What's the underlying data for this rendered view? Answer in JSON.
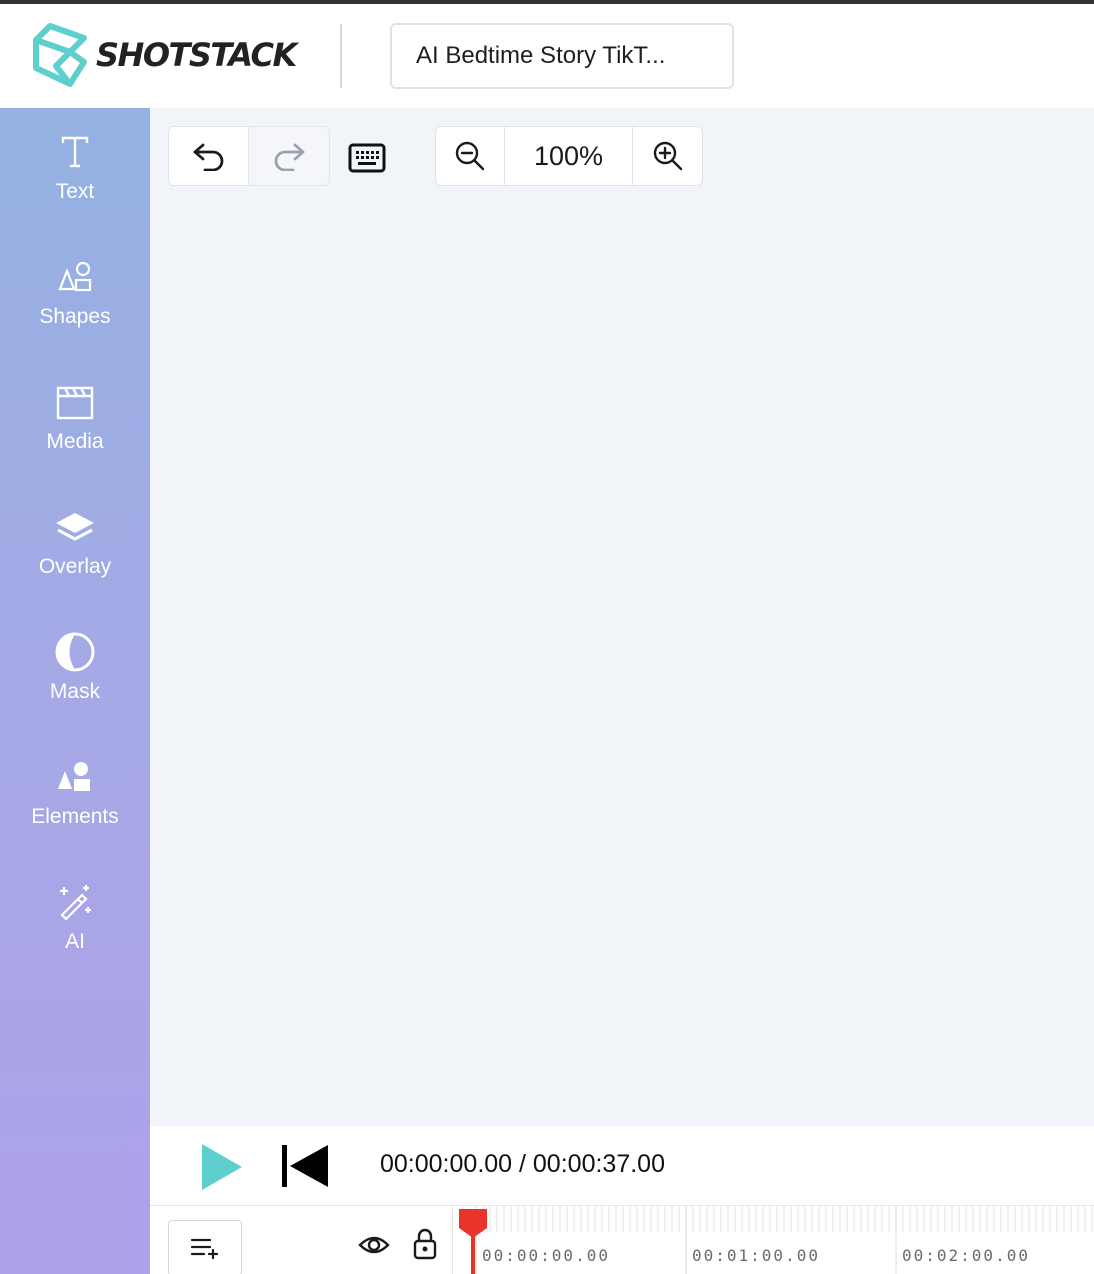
{
  "header": {
    "brand": "SHOTSTACK",
    "project_title": "AI Bedtime Story TikT..."
  },
  "sidebar": {
    "items": [
      {
        "id": "text",
        "label": "Text",
        "icon": "text-icon"
      },
      {
        "id": "shapes",
        "label": "Shapes",
        "icon": "shapes-icon"
      },
      {
        "id": "media",
        "label": "Media",
        "icon": "media-icon"
      },
      {
        "id": "overlay",
        "label": "Overlay",
        "icon": "overlay-icon"
      },
      {
        "id": "mask",
        "label": "Mask",
        "icon": "mask-icon"
      },
      {
        "id": "elements",
        "label": "Elements",
        "icon": "elements-icon"
      },
      {
        "id": "ai",
        "label": "AI",
        "icon": "ai-wand-icon"
      }
    ]
  },
  "toolbar": {
    "zoom": "100%",
    "redo_enabled": false
  },
  "playback": {
    "current_time": "00:00:00.00",
    "total_time": "00:00:37.00",
    "readout": "00:00:00.00 / 00:00:37.00"
  },
  "timeline": {
    "ticks": [
      "00:00:00.00",
      "00:01:00.00",
      "00:02:00.00"
    ]
  },
  "colors": {
    "brand_teal": "#5ecfcf",
    "sidebar_top": "#94b1e2",
    "sidebar_bottom": "#ada1e8",
    "canvas_bg": "#f1f4f9",
    "playhead": "#e8342a",
    "play_button": "#5ecfcf"
  }
}
